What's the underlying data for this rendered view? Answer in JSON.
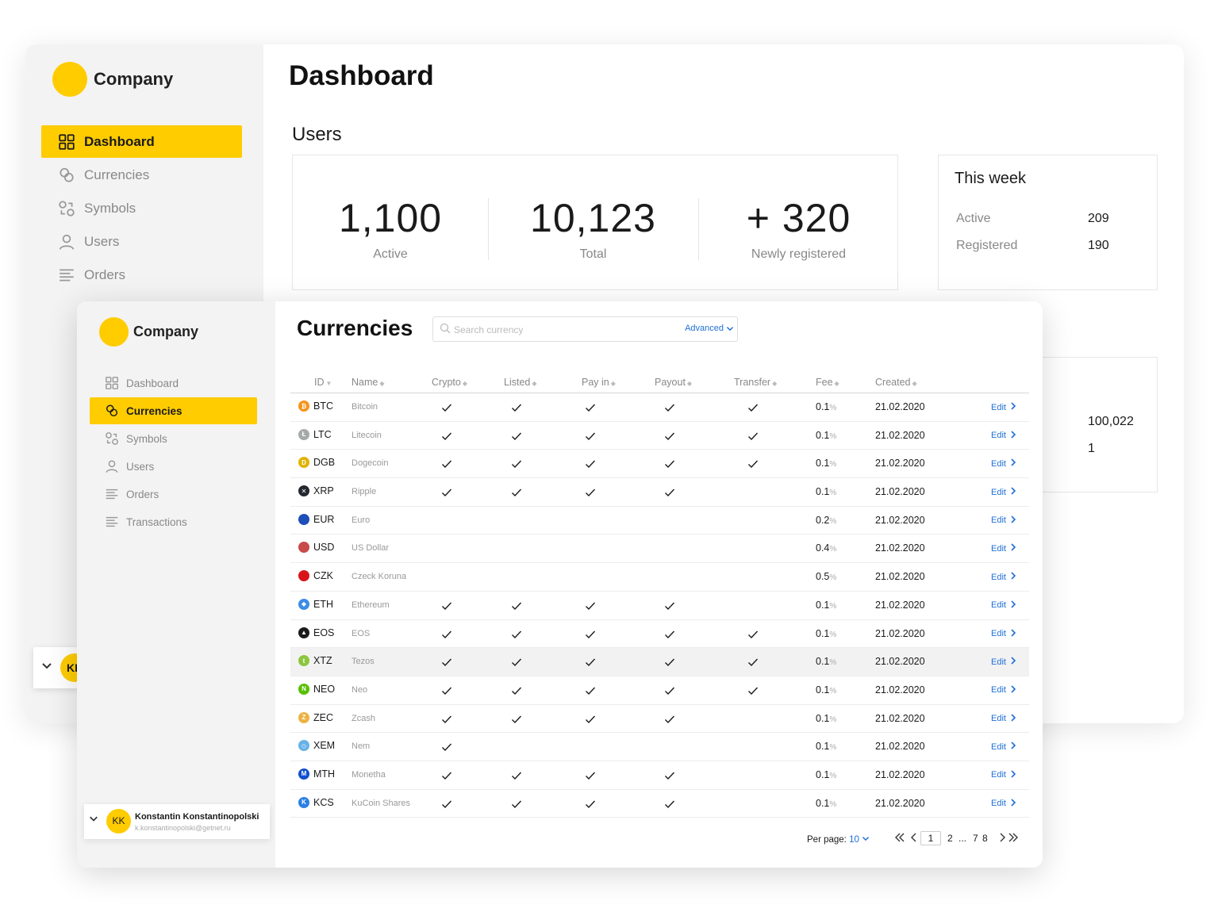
{
  "back": {
    "brand": "Company",
    "nav": [
      {
        "label": "Dashboard",
        "icon": "grid-icon",
        "active": true
      },
      {
        "label": "Currencies",
        "icon": "coins-icon",
        "active": false
      },
      {
        "label": "Symbols",
        "icon": "symbols-icon",
        "active": false
      },
      {
        "label": "Users",
        "icon": "user-icon",
        "active": false
      },
      {
        "label": "Orders",
        "icon": "list-icon",
        "active": false
      }
    ],
    "title": "Dashboard",
    "users_title": "Users",
    "stats": [
      {
        "value": "1,100",
        "label": "Active"
      },
      {
        "value": "10,123",
        "label": "Total"
      },
      {
        "value": "+ 320",
        "label": "Newly registered"
      }
    ],
    "week": {
      "title": "This week",
      "rows": [
        {
          "label": "Active",
          "value": "209"
        },
        {
          "label": "Registered",
          "value": "190"
        }
      ]
    },
    "third_card": {
      "v1": "100,022",
      "v2": "1"
    },
    "user_initials": "KK"
  },
  "front": {
    "brand": "Company",
    "nav": [
      {
        "label": "Dashboard",
        "icon": "grid-icon",
        "active": false
      },
      {
        "label": "Currencies",
        "icon": "coins-icon",
        "active": true
      },
      {
        "label": "Symbols",
        "icon": "symbols-icon",
        "active": false
      },
      {
        "label": "Users",
        "icon": "user-icon",
        "active": false
      },
      {
        "label": "Orders",
        "icon": "list-icon",
        "active": false
      },
      {
        "label": "Transactions",
        "icon": "list-icon",
        "active": false
      }
    ],
    "user": {
      "initials": "KK",
      "name": "Konstantin Konstantinopolski",
      "email": "k.konstantinopolski@getnet.ru"
    },
    "title": "Currencies",
    "search": {
      "placeholder": "Search currency",
      "advanced": "Advanced"
    },
    "columns": [
      "ID",
      "Name",
      "Crypto",
      "Listed",
      "Pay in",
      "Payout",
      "Transfer",
      "Fee",
      "Created"
    ],
    "edit_label": "Edit",
    "fee_unit": "%",
    "rows": [
      {
        "id": "BTC",
        "name": "Bitcoin",
        "color": "#f7931a",
        "glyph": "₿",
        "crypto": true,
        "listed": true,
        "payin": true,
        "payout": true,
        "transfer": true,
        "fee": "0.1",
        "created": "21.02.2020"
      },
      {
        "id": "LTC",
        "name": "Litecoin",
        "color": "#a6a9aa",
        "glyph": "Ł",
        "crypto": true,
        "listed": true,
        "payin": true,
        "payout": true,
        "transfer": true,
        "fee": "0.1",
        "created": "21.02.2020"
      },
      {
        "id": "DGB",
        "name": "Dogecoin",
        "color": "#e1b303",
        "glyph": "D",
        "crypto": true,
        "listed": true,
        "payin": true,
        "payout": true,
        "transfer": true,
        "fee": "0.1",
        "created": "21.02.2020"
      },
      {
        "id": "XRP",
        "name": "Ripple",
        "color": "#23292f",
        "glyph": "✕",
        "crypto": true,
        "listed": true,
        "payin": true,
        "payout": true,
        "transfer": false,
        "fee": "0.1",
        "created": "21.02.2020"
      },
      {
        "id": "EUR",
        "name": "Euro",
        "color": "#1e4fb8",
        "glyph": "",
        "crypto": false,
        "listed": false,
        "payin": false,
        "payout": false,
        "transfer": false,
        "fee": "0.2",
        "created": "21.02.2020"
      },
      {
        "id": "USD",
        "name": "US Dollar",
        "color": "#c94a4a",
        "glyph": "",
        "crypto": false,
        "listed": false,
        "payin": false,
        "payout": false,
        "transfer": false,
        "fee": "0.4",
        "created": "21.02.2020"
      },
      {
        "id": "CZK",
        "name": "Czeck Koruna",
        "color": "#d7141a",
        "glyph": "",
        "crypto": false,
        "listed": false,
        "payin": false,
        "payout": false,
        "transfer": false,
        "fee": "0.5",
        "created": "21.02.2020"
      },
      {
        "id": "ETH",
        "name": "Ethereum",
        "color": "#3c8ce7",
        "glyph": "◆",
        "crypto": true,
        "listed": true,
        "payin": true,
        "payout": true,
        "transfer": false,
        "fee": "0.1",
        "created": "21.02.2020"
      },
      {
        "id": "EOS",
        "name": "EOS",
        "color": "#1a1a1a",
        "glyph": "▲",
        "crypto": true,
        "listed": true,
        "payin": true,
        "payout": true,
        "transfer": true,
        "fee": "0.1",
        "created": "21.02.2020"
      },
      {
        "id": "XTZ",
        "name": "Tezos",
        "color": "#8cc63f",
        "glyph": "t",
        "crypto": true,
        "listed": true,
        "payin": true,
        "payout": true,
        "transfer": true,
        "fee": "0.1",
        "created": "21.02.2020",
        "highlight": true
      },
      {
        "id": "NEO",
        "name": "Neo",
        "color": "#58bf00",
        "glyph": "N",
        "crypto": true,
        "listed": true,
        "payin": true,
        "payout": true,
        "transfer": true,
        "fee": "0.1",
        "created": "21.02.2020"
      },
      {
        "id": "ZEC",
        "name": "Zcash",
        "color": "#ecb244",
        "glyph": "Z",
        "crypto": true,
        "listed": true,
        "payin": true,
        "payout": true,
        "transfer": false,
        "fee": "0.1",
        "created": "21.02.2020"
      },
      {
        "id": "XEM",
        "name": "Nem",
        "color": "#67b2e8",
        "glyph": "◇",
        "crypto": true,
        "listed": false,
        "payin": false,
        "payout": false,
        "transfer": false,
        "fee": "0.1",
        "created": "21.02.2020"
      },
      {
        "id": "MTH",
        "name": "Monetha",
        "color": "#104fcf",
        "glyph": "M",
        "crypto": true,
        "listed": true,
        "payin": true,
        "payout": true,
        "transfer": false,
        "fee": "0.1",
        "created": "21.02.2020"
      },
      {
        "id": "KCS",
        "name": "KuCoin Shares",
        "color": "#2b7fe6",
        "glyph": "K",
        "crypto": true,
        "listed": true,
        "payin": true,
        "payout": true,
        "transfer": false,
        "fee": "0.1",
        "created": "21.02.2020"
      }
    ],
    "pager": {
      "per_page_label": "Per page:",
      "per_page": "10",
      "pages": [
        "1",
        "2",
        "...",
        "7",
        "8"
      ]
    }
  },
  "colors": {
    "accent": "#ffcc00",
    "link": "#1e6fd9"
  }
}
